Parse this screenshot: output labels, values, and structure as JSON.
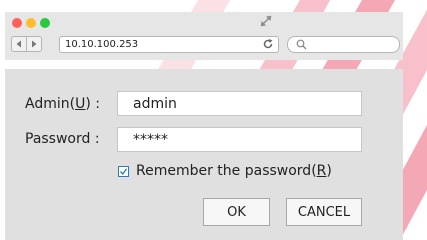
{
  "browser": {
    "url": "10.10.100.253",
    "icons": [
      "back-arrow",
      "forward-arrow",
      "reload",
      "search",
      "fullscreen-expand"
    ],
    "colors": {
      "close": "#ff5f57",
      "minimize": "#febc2e",
      "maximize": "#28c840"
    }
  },
  "login": {
    "admin_label_prefix": "Admin(",
    "admin_label_key": "U",
    "admin_label_suffix": ") :",
    "admin_value": "admin",
    "password_label": "Password :",
    "password_value": "*****",
    "remember_label_prefix": "Remember the password(",
    "remember_label_key": "R",
    "remember_label_suffix": ")",
    "remember_checked": true,
    "ok_label": "OK",
    "cancel_label": "CANCEL"
  },
  "background": {
    "stripe_color": "#e8002a"
  }
}
